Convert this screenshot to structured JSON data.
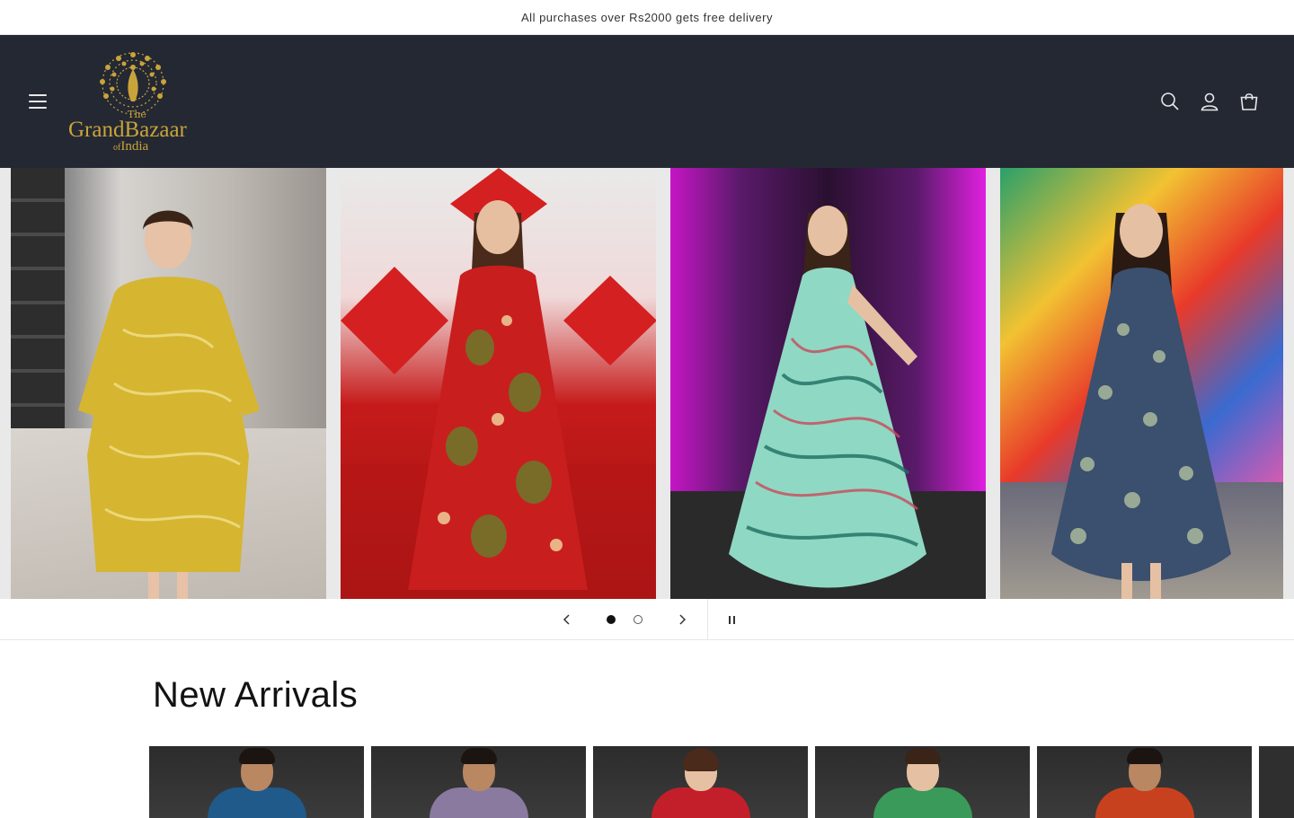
{
  "announcement": "All purchases over Rs2000 gets free delivery",
  "header": {
    "logo": {
      "the": "The",
      "name": "GrandBazaar",
      "of": "of",
      "country": "India"
    },
    "icons": [
      "menu-icon",
      "search-icon",
      "account-icon",
      "cart-icon"
    ]
  },
  "slideshow": {
    "active_slide": 1,
    "slide_count": 2
  },
  "section": {
    "title": "New Arrivals"
  },
  "colors": {
    "header_bg": "#242833",
    "logo_gold": "#c9a43a",
    "text": "#121212"
  }
}
